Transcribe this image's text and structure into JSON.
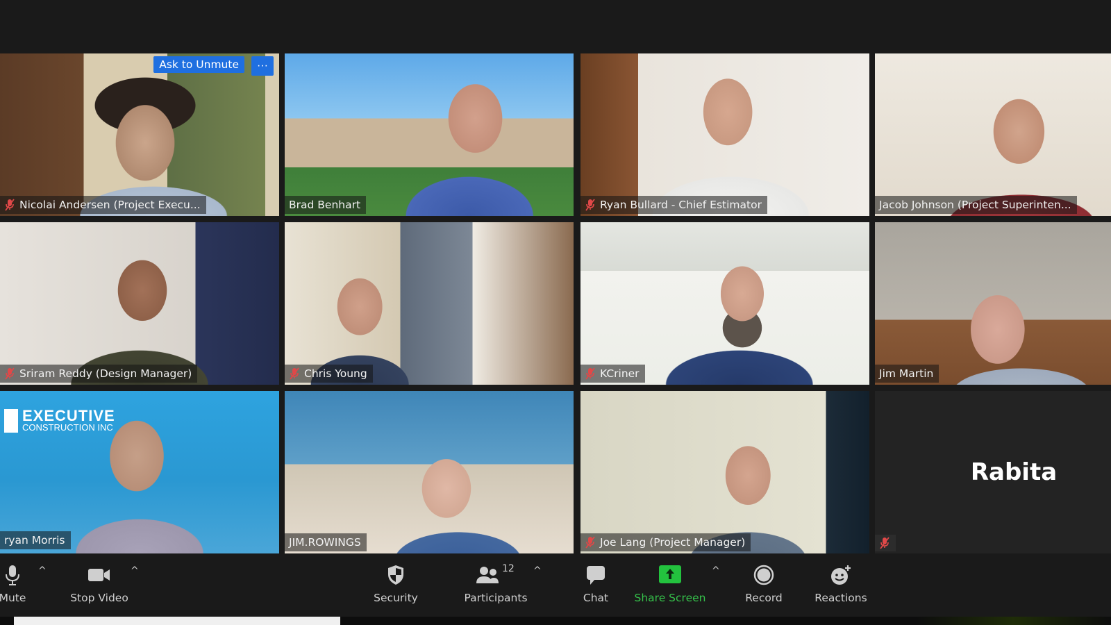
{
  "gallery": {
    "participants": [
      {
        "name": "Nicolai Andersen (Project Execu...",
        "muted": true,
        "ask_to_unmute_label": "Ask to Unmute",
        "more_label": "···"
      },
      {
        "name": "Brad Benhart",
        "muted": false
      },
      {
        "name": "Ryan Bullard - Chief Estimator",
        "muted": true
      },
      {
        "name": "Jacob Johnson (Project Superinten...",
        "muted": false
      },
      {
        "name": "Sriram Reddy (Design Manager)",
        "muted": true
      },
      {
        "name": "Chris Young",
        "muted": true
      },
      {
        "name": "KCriner",
        "muted": true
      },
      {
        "name": "Jim Martin",
        "muted": false
      },
      {
        "name": "ryan Morris",
        "muted": false,
        "active_speaker": true,
        "background_text": "EXECUTIVE",
        "background_subtext": "CONSTRUCTION INC"
      },
      {
        "name": "JIM.ROWINGS",
        "muted": false
      },
      {
        "name": "Joe Lang (Project Manager)",
        "muted": true
      },
      {
        "name": "",
        "display_name": "Rabita",
        "muted": true,
        "video_off": true
      }
    ]
  },
  "toolbar": {
    "mute": {
      "label": "Mute",
      "icon": "microphone-icon"
    },
    "video": {
      "label": "Stop Video",
      "icon": "video-camera-icon"
    },
    "security": {
      "label": "Security",
      "icon": "shield-icon"
    },
    "participants": {
      "label": "Participants",
      "count": "12",
      "icon": "participants-icon"
    },
    "chat": {
      "label": "Chat",
      "icon": "chat-bubble-icon"
    },
    "share": {
      "label": "Share Screen",
      "icon": "share-screen-icon"
    },
    "record": {
      "label": "Record",
      "icon": "record-icon"
    },
    "reactions": {
      "label": "Reactions",
      "icon": "reactions-icon"
    },
    "caret": "^"
  },
  "colors": {
    "share_green": "#35c04a",
    "active_speaker_border": "#e8e860",
    "unmute_blue": "#1f6fe0",
    "muted_red": "#e04848"
  }
}
